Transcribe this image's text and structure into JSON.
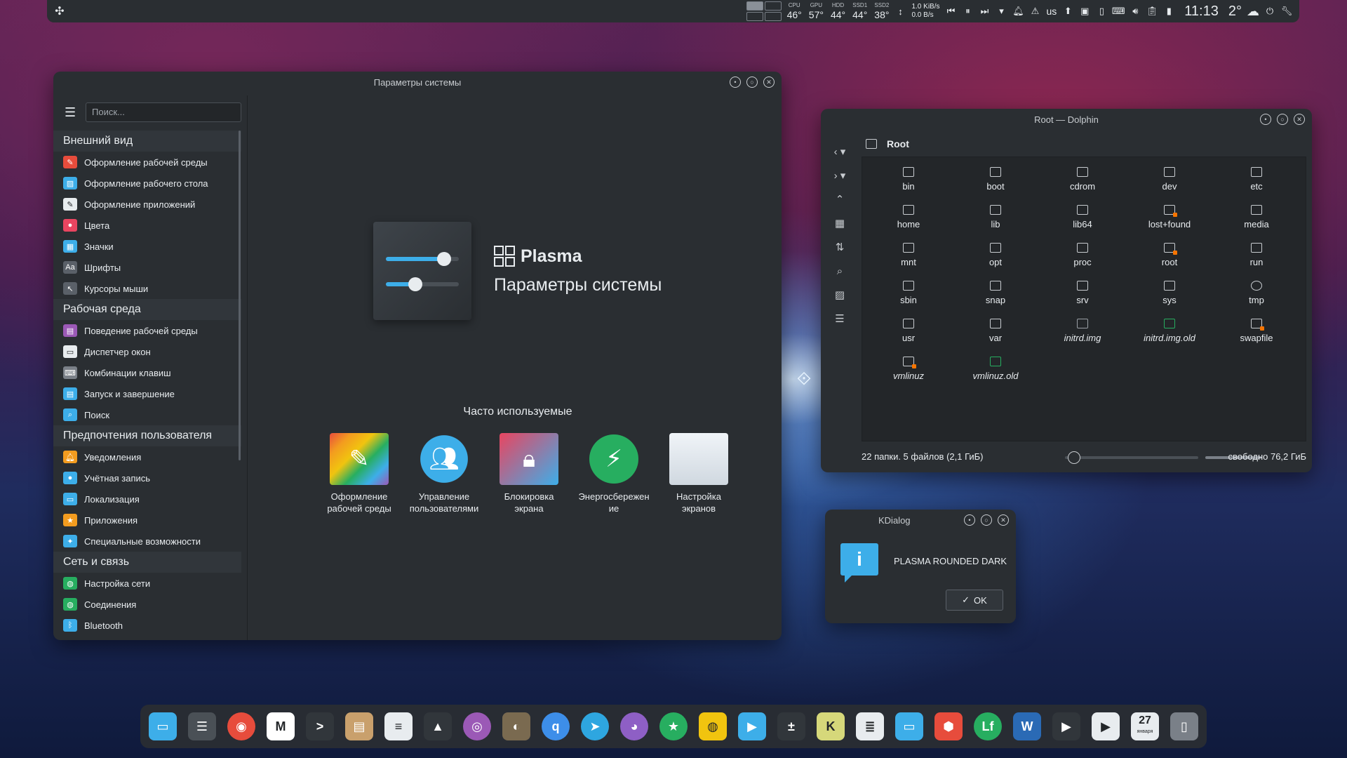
{
  "top_panel": {
    "sensors": [
      {
        "label": "CPU",
        "value": "46°"
      },
      {
        "label": "GPU",
        "value": "57°"
      },
      {
        "label": "HDD",
        "value": "44°"
      },
      {
        "label": "SSD1",
        "value": "44°"
      },
      {
        "label": "SSD2",
        "value": "38°"
      }
    ],
    "net_down": "1.0 KiB/s",
    "net_up": "0.0 B/s",
    "keyboard_layout": "us",
    "clock": "11:13",
    "weather_temp": "2°"
  },
  "settings": {
    "title": "Параметры системы",
    "search_placeholder": "Поиск...",
    "sidebar": [
      {
        "type": "category",
        "label": "Внешний вид"
      },
      {
        "type": "item",
        "label": "Оформление рабочей среды",
        "icon": "workspace-theme-icon",
        "color": "#e74c3c"
      },
      {
        "type": "item",
        "label": "Оформление рабочего стола",
        "icon": "desktop-theme-icon",
        "color": "#3daee9"
      },
      {
        "type": "item",
        "label": "Оформление приложений",
        "icon": "app-style-icon",
        "color": "#e8ecef"
      },
      {
        "type": "item",
        "label": "Цвета",
        "icon": "colors-icon",
        "color": "#e94560"
      },
      {
        "type": "item",
        "label": "Значки",
        "icon": "icons-icon",
        "color": "#3daee9"
      },
      {
        "type": "item",
        "label": "Шрифты",
        "icon": "fonts-icon",
        "color": "#5a6068"
      },
      {
        "type": "item",
        "label": "Курсоры мыши",
        "icon": "cursor-icon",
        "color": "#5a6068"
      },
      {
        "type": "category",
        "label": "Рабочая среда"
      },
      {
        "type": "item",
        "label": "Поведение рабочей среды",
        "icon": "workspace-behavior-icon",
        "color": "#9b59b6"
      },
      {
        "type": "item",
        "label": "Диспетчер окон",
        "icon": "window-manager-icon",
        "color": "#e8ecef"
      },
      {
        "type": "item",
        "label": "Комбинации клавиш",
        "icon": "keyboard-icon",
        "color": "#7a8088"
      },
      {
        "type": "item",
        "label": "Запуск и завершение",
        "icon": "startup-icon",
        "color": "#3daee9"
      },
      {
        "type": "item",
        "label": "Поиск",
        "icon": "search-icon",
        "color": "#3daee9"
      },
      {
        "type": "category",
        "label": "Предпочтения пользователя"
      },
      {
        "type": "item",
        "label": "Уведомления",
        "icon": "bell-icon",
        "color": "#f39c1f"
      },
      {
        "type": "item",
        "label": "Учётная запись",
        "icon": "account-icon",
        "color": "#3daee9"
      },
      {
        "type": "item",
        "label": "Локализация",
        "icon": "locale-icon",
        "color": "#3daee9"
      },
      {
        "type": "item",
        "label": "Приложения",
        "icon": "star-icon",
        "color": "#f39c1f"
      },
      {
        "type": "item",
        "label": "Специальные возможности",
        "icon": "accessibility-icon",
        "color": "#3daee9"
      },
      {
        "type": "category",
        "label": "Сеть и связь"
      },
      {
        "type": "item",
        "label": "Настройка сети",
        "icon": "network-icon",
        "color": "#27ae60"
      },
      {
        "type": "item",
        "label": "Соединения",
        "icon": "connections-icon",
        "color": "#27ae60"
      },
      {
        "type": "item",
        "label": "Bluetooth",
        "icon": "bluetooth-icon",
        "color": "#3daee9"
      }
    ],
    "hero": {
      "brand": "Plasma",
      "subtitle": "Параметры системы"
    },
    "slider_levels": [
      0.8,
      0.4
    ],
    "frequent_label": "Часто используемые",
    "frequent": [
      {
        "label": "Оформление\nрабочей среды",
        "icon": "workspace-theme-icon"
      },
      {
        "label": "Управление\nпользователями",
        "icon": "users-icon"
      },
      {
        "label": "Блокировка\nэкрана",
        "icon": "lock-screen-icon"
      },
      {
        "label": "Энергосбережен\nие",
        "icon": "power-icon"
      },
      {
        "label": "Настройка\nэкранов",
        "icon": "display-icon"
      }
    ]
  },
  "dolphin": {
    "title": "Root — Dolphin",
    "location": "Root",
    "files": [
      {
        "name": "bin",
        "kind": "folder"
      },
      {
        "name": "boot",
        "kind": "folder"
      },
      {
        "name": "cdrom",
        "kind": "folder"
      },
      {
        "name": "dev",
        "kind": "folder"
      },
      {
        "name": "etc",
        "kind": "folder"
      },
      {
        "name": "home",
        "kind": "folder"
      },
      {
        "name": "lib",
        "kind": "folder"
      },
      {
        "name": "lib64",
        "kind": "folder"
      },
      {
        "name": "lost+found",
        "kind": "locked"
      },
      {
        "name": "media",
        "kind": "folder"
      },
      {
        "name": "mnt",
        "kind": "folder"
      },
      {
        "name": "opt",
        "kind": "folder"
      },
      {
        "name": "proc",
        "kind": "folder"
      },
      {
        "name": "root",
        "kind": "locked"
      },
      {
        "name": "run",
        "kind": "folder"
      },
      {
        "name": "sbin",
        "kind": "folder"
      },
      {
        "name": "snap",
        "kind": "folder"
      },
      {
        "name": "srv",
        "kind": "folder"
      },
      {
        "name": "sys",
        "kind": "folder"
      },
      {
        "name": "tmp",
        "kind": "clock"
      },
      {
        "name": "usr",
        "kind": "folder"
      },
      {
        "name": "var",
        "kind": "folder"
      },
      {
        "name": "initrd.img",
        "kind": "file"
      },
      {
        "name": "initrd.img.old",
        "kind": "link"
      },
      {
        "name": "swapfile",
        "kind": "locked"
      },
      {
        "name": "vmlinuz",
        "kind": "locked"
      },
      {
        "name": "vmlinuz.old",
        "kind": "link"
      }
    ],
    "status_left": "22 папки. 5 файлов (2,1 ГиБ)",
    "status_right": "свободно 76,2 ГиБ"
  },
  "kdialog": {
    "title": "KDialog",
    "message": "PLASMA ROUNDED DARK",
    "ok_label": "OK"
  },
  "dock": {
    "apps": [
      {
        "icon": "files-icon",
        "color": "#3daee9",
        "glyph": "▭"
      },
      {
        "icon": "settings-icon",
        "color": "#4a5056",
        "glyph": "☰"
      },
      {
        "icon": "chrome-icon",
        "color": "#e74c3c",
        "glyph": "◉"
      },
      {
        "icon": "gmail-icon",
        "color": "#ffffff",
        "glyph": "M"
      },
      {
        "icon": "terminal-icon",
        "color": "#31363b",
        "glyph": ">"
      },
      {
        "icon": "archive-icon",
        "color": "#c9a06c",
        "glyph": "▤"
      },
      {
        "icon": "text-editor-icon",
        "color": "#e8ecef",
        "glyph": "≡"
      },
      {
        "icon": "inkscape-icon",
        "color": "#31363b",
        "glyph": "▲"
      },
      {
        "icon": "color-picker-icon",
        "color": "#9b59b6",
        "glyph": "◎"
      },
      {
        "icon": "gimp-icon",
        "color": "#7a6a50",
        "glyph": "◐"
      },
      {
        "icon": "qbittorrent-icon",
        "color": "#3d8ee9",
        "glyph": "q"
      },
      {
        "icon": "telegram-icon",
        "color": "#2ea6e0",
        "glyph": "➤"
      },
      {
        "icon": "github-icon",
        "color": "#8e5fc5",
        "glyph": "◕"
      },
      {
        "icon": "favorites-icon",
        "color": "#27ae60",
        "glyph": "★"
      },
      {
        "icon": "radio-icon",
        "color": "#f1c40f",
        "glyph": "◍"
      },
      {
        "icon": "media-player-icon",
        "color": "#3daee9",
        "glyph": "▶"
      },
      {
        "icon": "calculator-icon",
        "color": "#31363b",
        "glyph": "±"
      },
      {
        "icon": "kile-icon",
        "color": "#d6d87a",
        "glyph": "K"
      },
      {
        "icon": "mixer-icon",
        "color": "#e8ecef",
        "glyph": "≣"
      },
      {
        "icon": "folder-icon",
        "color": "#3daee9",
        "glyph": "▭"
      },
      {
        "icon": "shield-icon",
        "color": "#e74c3c",
        "glyph": "⬢"
      },
      {
        "icon": "lf-icon",
        "color": "#27ae60",
        "glyph": "Lf"
      },
      {
        "icon": "w-editor-icon",
        "color": "#2a6ab5",
        "glyph": "W"
      },
      {
        "icon": "video-icon",
        "color": "#31363b",
        "glyph": "▶"
      },
      {
        "icon": "play-icon",
        "color": "#e8ecef",
        "glyph": "▶"
      },
      {
        "icon": "calendar-icon",
        "color": "#e8ecef",
        "glyph": "27"
      },
      {
        "icon": "trash-icon",
        "color": "#7a8088",
        "glyph": "▯"
      }
    ],
    "calendar_day": "27",
    "calendar_month": "января"
  }
}
